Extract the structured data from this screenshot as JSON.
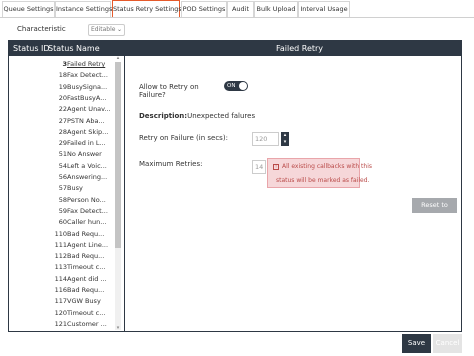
{
  "tabs": [
    {
      "label": "Queue Settings",
      "active": false
    },
    {
      "label": "Instance Settings",
      "active": false
    },
    {
      "label": "Status Retry Settings",
      "active": true
    },
    {
      "label": "POD Settings",
      "active": false
    },
    {
      "label": "Audit",
      "active": false
    },
    {
      "label": "Bulk Upload",
      "active": false
    },
    {
      "label": "Interval Usage",
      "active": false
    }
  ],
  "characteristic": {
    "label": "Characteristic",
    "value": "Editable"
  },
  "table_header": {
    "status_id": "Status ID",
    "status_name": "Status Name",
    "detail_title": "Failed Retry"
  },
  "statuses": [
    {
      "id": "3",
      "name": "Failed Retry",
      "selected": true
    },
    {
      "id": "18",
      "name": "Fax Detect..."
    },
    {
      "id": "19",
      "name": "BusySigna..."
    },
    {
      "id": "20",
      "name": "FastBusyA..."
    },
    {
      "id": "22",
      "name": "Agent Unav..."
    },
    {
      "id": "27",
      "name": "PSTN Aba..."
    },
    {
      "id": "28",
      "name": "Agent Skip..."
    },
    {
      "id": "29",
      "name": "Failed in L..."
    },
    {
      "id": "51",
      "name": "No Answer"
    },
    {
      "id": "54",
      "name": "Left a Voic..."
    },
    {
      "id": "56",
      "name": "Answering..."
    },
    {
      "id": "57",
      "name": "Busy"
    },
    {
      "id": "58",
      "name": "Person No..."
    },
    {
      "id": "59",
      "name": "Fax Detect..."
    },
    {
      "id": "60",
      "name": "Caller hun..."
    },
    {
      "id": "110",
      "name": "Bad Requ..."
    },
    {
      "id": "111",
      "name": "Agent Line..."
    },
    {
      "id": "112",
      "name": "Bad Requ..."
    },
    {
      "id": "113",
      "name": "Timeout c..."
    },
    {
      "id": "114",
      "name": "Agent did ..."
    },
    {
      "id": "116",
      "name": "Bad Requ..."
    },
    {
      "id": "117",
      "name": "VGW Busy"
    },
    {
      "id": "120",
      "name": "Timeout c..."
    },
    {
      "id": "121",
      "name": "Customer ..."
    }
  ],
  "detail": {
    "allow_retry_label_1": "Allow to Retry on",
    "allow_retry_label_2": "Failure?",
    "toggle_text": "ON",
    "description_key": "Description:",
    "description_value": "Unexpected falures",
    "retry_secs_label": "Retry on Failure (in secs):",
    "retry_secs_value": "120",
    "max_retries_label": "Maximum Retries:",
    "max_retries_value": "14",
    "alert_line1": "All existing callbacks with this",
    "alert_line2": "status will be marked as failed.",
    "reset_label": "Reset to Default"
  },
  "footer": {
    "save_label": "Save",
    "cancel_label": "Cancel"
  },
  "colors": {
    "header_bg": "#2e3844",
    "active_tab_border": "#e55a2b",
    "alert_bg": "#f6d7d9",
    "alert_text": "#b94a48"
  }
}
